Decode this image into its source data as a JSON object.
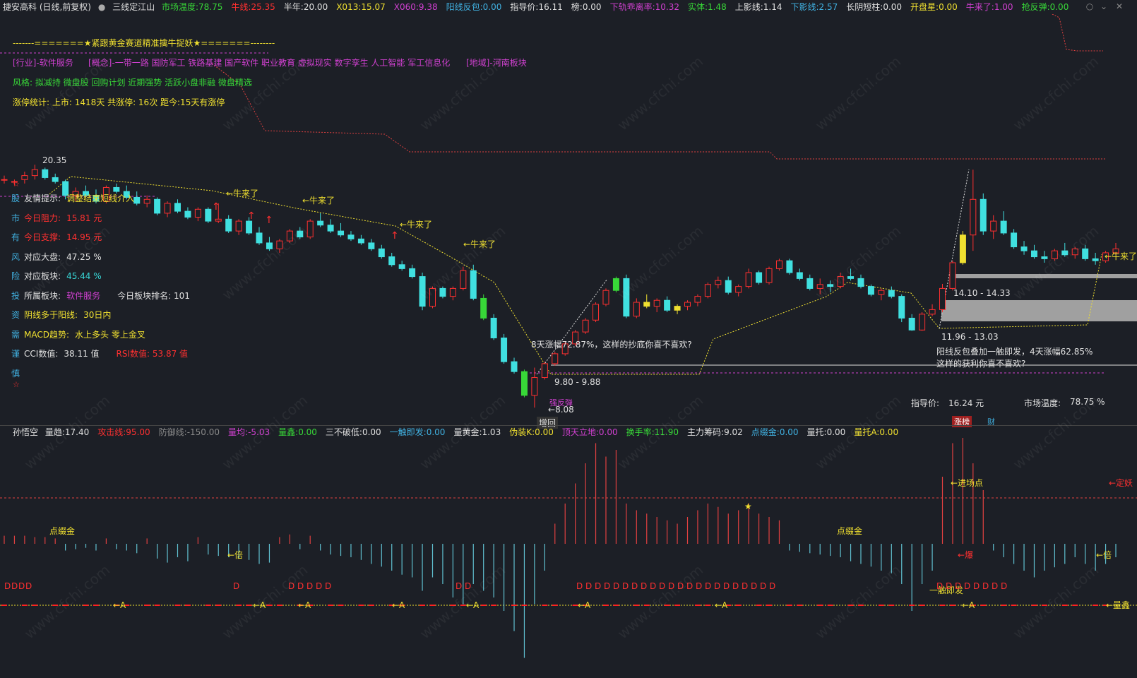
{
  "header": {
    "stock": "捷安高科 (日线,前复权)",
    "indicator": "三线定江山",
    "items": [
      {
        "label": "市场温度:",
        "value": "78.75",
        "color": "#38d838"
      },
      {
        "label": "牛线:",
        "value": "25.35",
        "color": "#ff3030"
      },
      {
        "label": "半年:",
        "value": "20.00",
        "color": "#e0e0e0"
      },
      {
        "label": "X013:",
        "value": "15.07",
        "color": "#f0e030"
      },
      {
        "label": "X060:",
        "value": "9.38",
        "color": "#d040d0"
      },
      {
        "label": "阳线反包:",
        "value": "0.00",
        "color": "#40b0e0"
      },
      {
        "label": "指导价:",
        "value": "16.11",
        "color": "#e0e0e0"
      },
      {
        "label": "榜:",
        "value": "0.00",
        "color": "#e0e0e0"
      },
      {
        "label": "下轨乖离率:",
        "value": "10.32",
        "color": "#d040d0"
      },
      {
        "label": "实体:",
        "value": "1.48",
        "color": "#38d838"
      },
      {
        "label": "上影线:",
        "value": "1.14",
        "color": "#e0e0e0"
      },
      {
        "label": "下影线:",
        "value": "2.57",
        "color": "#40b0e0"
      },
      {
        "label": "长阴短柱:",
        "value": "0.00",
        "color": "#e0e0e0"
      },
      {
        "label": "开盘星:",
        "value": "0.00",
        "color": "#f0e030"
      },
      {
        "label": "牛来了:",
        "value": "1.00",
        "color": "#d040d0"
      },
      {
        "label": "抢反弹:",
        "value": "0.00",
        "color": "#38d838"
      }
    ]
  },
  "overlay": {
    "banner": "-------=======★紧跟黄金赛道精准擒牛捉妖★=======--------",
    "industry": "[行业]-软件服务",
    "concept": "[概念]-一带一路 国防军工 铁路基建 国产软件 职业教育 虚拟现实 数字孪生 人工智能 军工信息化",
    "region": "[地域]-河南板块",
    "style": "风格: 拟减持 微盘股 回购计划 近期强势 活跃小盘非融 微盘精选",
    "limit_stats": "涨停统计:   上市: 1418天   共涨停: 16次   距今:15天有涨停"
  },
  "info_panel": [
    {
      "tag": "股",
      "label": "友情提示:",
      "value": "调整结束短线介入",
      "tag_color": "#40b0e0",
      "label_color": "#e0e0e0",
      "value_color": "#f0e030"
    },
    {
      "tag": "市",
      "label": "今日阻力:",
      "value": "15.81 元",
      "tag_color": "#40b0e0",
      "label_color": "#ff3030",
      "value_color": "#ff3030"
    },
    {
      "tag": "有",
      "label": "今日支撑:",
      "value": "14.95 元",
      "tag_color": "#40b0e0",
      "label_color": "#ff3030",
      "value_color": "#ff3030"
    },
    {
      "tag": "风",
      "label": "对应大盘:",
      "value": "47.25 %",
      "tag_color": "#40b0e0",
      "label_color": "#e0e0e0",
      "value_color": "#e0e0e0"
    },
    {
      "tag": "险",
      "label": "对应板块:",
      "value": "45.44 %",
      "tag_color": "#40b0e0",
      "label_color": "#e0e0e0",
      "value_color": "#38d8d8"
    },
    {
      "tag": "投",
      "label": "所属板块:",
      "value": "软件服务",
      "extra_label": "今日板块排名:",
      "extra_value": "101",
      "tag_color": "#40b0e0",
      "label_color": "#e0e0e0",
      "value_color": "#d040d0"
    },
    {
      "tag": "资",
      "label": "阴线多于阳线:",
      "value": "30日内",
      "tag_color": "#40b0e0",
      "label_color": "#f0e030",
      "value_color": "#f0e030"
    },
    {
      "tag": "需",
      "label": "MACD趋势:",
      "value": "水上多头 零上金叉",
      "tag_color": "#40b0e0",
      "label_color": "#f0e030",
      "value_color": "#f0e030"
    },
    {
      "tag": "谨",
      "label": "CCI数值:",
      "value": "38.11 值",
      "extra_label": "RSI数值:",
      "extra_value": "53.87 值",
      "tag_color": "#40b0e0",
      "label_color": "#e0e0e0",
      "value_color": "#e0e0e0"
    },
    {
      "tag": "慎",
      "label": "",
      "value": "",
      "tag_color": "#40b0e0",
      "label_color": "#e0e0e0",
      "value_color": "#e0e0e0"
    }
  ],
  "annotations": {
    "high_label": "20.35",
    "low_label": "8.08",
    "bull_label": "牛来了",
    "bull_arrow_label": "←牛来了",
    "rally1": "8天涨幅72.87%，这样的抄底你喜不喜欢?",
    "rally2_line1": "阳线反包叠加一触即发，4天涨幅62.85%",
    "rally2_line2": "这样的获利你喜不喜欢?",
    "box1": "14.10 - 14.33",
    "box2": "11.96 - 13.03",
    "box3": "9.80 - 9.88",
    "pullback": "增回",
    "guide_price_label": "指导价:",
    "guide_price_value": "16.24 元",
    "market_temp_label": "市场温度:",
    "market_temp_value": "78.75 %",
    "zhangbang": "涨榜",
    "cai": "财",
    "low_pink": "强反弹"
  },
  "sub_header": {
    "name": "孙悟空",
    "items": [
      {
        "label": "量趋:",
        "value": "17.40",
        "color": "#e0e0e0"
      },
      {
        "label": "攻击线:",
        "value": "95.00",
        "color": "#ff3030"
      },
      {
        "label": "防御线:",
        "value": "-150.00",
        "color": "#888888"
      },
      {
        "label": "量均:",
        "value": "-5.03",
        "color": "#d040d0"
      },
      {
        "label": "量鑫:",
        "value": "0.00",
        "color": "#38d838"
      },
      {
        "label": "三不破低:",
        "value": "0.00",
        "color": "#e0e0e0"
      },
      {
        "label": "一触即发:",
        "value": "0.00",
        "color": "#40b0e0"
      },
      {
        "label": "量黄金:",
        "value": "1.03",
        "color": "#e0e0e0"
      },
      {
        "label": "伪装K:",
        "value": "0.00",
        "color": "#f0e030"
      },
      {
        "label": "顶天立地:",
        "value": "0.00",
        "color": "#d040d0"
      },
      {
        "label": "换手率:",
        "value": "11.90",
        "color": "#38d838"
      },
      {
        "label": "主力筹码:",
        "value": "9.02",
        "color": "#e0e0e0"
      },
      {
        "label": "点缀金:",
        "value": "0.00",
        "color": "#40b0e0"
      },
      {
        "label": "量托:",
        "value": "0.00",
        "color": "#e0e0e0"
      },
      {
        "label": "量托A:",
        "value": "0.00",
        "color": "#f0e030"
      }
    ],
    "labels": {
      "dingyao": "定妖",
      "liangxin": "量鑫",
      "jinchangdian": "进场点",
      "dianzhuijin": "点缀金",
      "bei": "←倍",
      "bao": "←爆",
      "yichujifa": "一触即发",
      "arrow_a": "←A",
      "d": "D"
    }
  },
  "chart_data": {
    "type": "candlestick",
    "title": "",
    "ylabel": "",
    "candles": [
      [
        19.6,
        19.8,
        19.4,
        19.6
      ],
      [
        19.5,
        19.6,
        19.3,
        19.5
      ],
      [
        19.6,
        20.0,
        19.4,
        19.8
      ],
      [
        19.8,
        20.35,
        19.6,
        20.1
      ],
      [
        20.1,
        20.2,
        19.6,
        19.7
      ],
      [
        19.7,
        19.9,
        19.4,
        19.5
      ],
      [
        19.5,
        19.6,
        18.6,
        18.8
      ],
      [
        18.8,
        19.2,
        18.5,
        19.0
      ],
      [
        19.0,
        19.3,
        18.7,
        18.8
      ],
      [
        18.8,
        19.1,
        18.4,
        18.5
      ],
      [
        18.5,
        19.3,
        18.4,
        19.2
      ],
      [
        19.2,
        19.4,
        18.9,
        19.0
      ],
      [
        19.0,
        19.3,
        18.6,
        18.7
      ],
      [
        18.7,
        19.0,
        18.3,
        18.4
      ],
      [
        18.4,
        18.8,
        18.2,
        18.6
      ],
      [
        18.6,
        18.7,
        17.8,
        17.9
      ],
      [
        17.9,
        18.5,
        17.7,
        18.4
      ],
      [
        18.4,
        18.6,
        17.9,
        18.0
      ],
      [
        18.0,
        18.2,
        17.6,
        17.7
      ],
      [
        17.7,
        18.2,
        17.5,
        18.1
      ],
      [
        18.1,
        18.2,
        17.4,
        17.5
      ],
      [
        17.5,
        18.4,
        17.4,
        17.6
      ],
      [
        17.6,
        17.8,
        16.9,
        17.0
      ],
      [
        17.0,
        17.6,
        16.8,
        17.5
      ],
      [
        17.5,
        17.7,
        16.8,
        16.9
      ],
      [
        16.9,
        17.2,
        16.3,
        16.4
      ],
      [
        16.4,
        16.7,
        16.0,
        16.1
      ],
      [
        16.1,
        16.6,
        15.9,
        16.5
      ],
      [
        16.5,
        17.1,
        16.4,
        17.0
      ],
      [
        17.0,
        17.2,
        16.6,
        16.7
      ],
      [
        16.7,
        17.6,
        16.6,
        17.5
      ],
      [
        17.5,
        17.9,
        17.2,
        17.3
      ],
      [
        17.3,
        17.6,
        16.9,
        17.0
      ],
      [
        17.0,
        17.4,
        16.7,
        16.8
      ],
      [
        16.8,
        17.0,
        16.5,
        16.6
      ],
      [
        16.6,
        16.8,
        16.3,
        16.4
      ],
      [
        16.4,
        16.6,
        16.0,
        16.1
      ],
      [
        16.1,
        16.3,
        15.6,
        15.7
      ],
      [
        15.7,
        15.9,
        15.2,
        15.3
      ],
      [
        15.3,
        15.5,
        15.0,
        15.1
      ],
      [
        15.1,
        15.3,
        14.6,
        14.7
      ],
      [
        14.7,
        14.9,
        13.0,
        13.2
      ],
      [
        13.2,
        14.2,
        13.1,
        14.1
      ],
      [
        14.1,
        14.2,
        13.6,
        13.7
      ],
      [
        13.7,
        14.2,
        13.5,
        14.1
      ],
      [
        14.1,
        15.2,
        14.0,
        15.0
      ],
      [
        15.0,
        15.3,
        13.5,
        13.6
      ],
      [
        13.6,
        13.8,
        12.5,
        12.6
      ],
      [
        12.6,
        12.8,
        11.5,
        11.6
      ],
      [
        11.6,
        11.8,
        10.3,
        10.4
      ],
      [
        10.4,
        10.6,
        9.8,
        9.9
      ],
      [
        9.9,
        10.0,
        8.6,
        8.7
      ],
      [
        8.7,
        10.1,
        8.08,
        9.6
      ],
      [
        9.6,
        10.4,
        9.5,
        10.3
      ],
      [
        10.3,
        10.9,
        10.2,
        10.8
      ],
      [
        10.8,
        11.4,
        10.7,
        11.3
      ],
      [
        11.3,
        12.0,
        11.2,
        11.9
      ],
      [
        11.9,
        12.6,
        11.8,
        12.5
      ],
      [
        12.5,
        13.4,
        12.4,
        13.3
      ],
      [
        13.3,
        14.1,
        13.2,
        14.0
      ],
      [
        14.0,
        14.7,
        13.9,
        14.6
      ],
      [
        14.6,
        14.8,
        12.6,
        12.7
      ],
      [
        12.7,
        13.6,
        12.6,
        13.4
      ],
      [
        13.4,
        13.8,
        13.1,
        13.2
      ],
      [
        13.2,
        13.6,
        12.9,
        13.5
      ],
      [
        13.5,
        13.7,
        12.9,
        13.0
      ],
      [
        13.0,
        13.3,
        12.8,
        13.2
      ],
      [
        13.2,
        13.5,
        13.0,
        13.4
      ],
      [
        13.4,
        13.8,
        13.2,
        13.7
      ],
      [
        13.7,
        14.4,
        13.6,
        14.3
      ],
      [
        14.3,
        14.7,
        14.1,
        14.5
      ],
      [
        14.5,
        14.7,
        13.8,
        13.9
      ],
      [
        13.9,
        14.3,
        13.7,
        14.2
      ],
      [
        14.2,
        15.1,
        14.1,
        14.9
      ],
      [
        14.9,
        15.0,
        14.3,
        14.4
      ],
      [
        14.4,
        15.2,
        14.3,
        15.1
      ],
      [
        15.1,
        15.6,
        15.0,
        15.5
      ],
      [
        15.5,
        15.6,
        14.8,
        14.9
      ],
      [
        14.9,
        15.1,
        14.5,
        14.6
      ],
      [
        14.6,
        14.8,
        14.0,
        14.1
      ],
      [
        14.1,
        14.6,
        13.8,
        14.3
      ],
      [
        14.3,
        14.5,
        13.9,
        14.2
      ],
      [
        14.2,
        14.9,
        14.1,
        14.7
      ],
      [
        14.7,
        15.1,
        14.5,
        14.6
      ],
      [
        14.6,
        14.8,
        14.1,
        14.2
      ],
      [
        14.2,
        14.3,
        13.7,
        13.8
      ],
      [
        13.8,
        14.1,
        13.5,
        14.0
      ],
      [
        14.0,
        14.2,
        13.6,
        13.7
      ],
      [
        13.7,
        13.8,
        12.4,
        12.6
      ],
      [
        12.6,
        12.8,
        11.96,
        12.0
      ],
      [
        12.0,
        12.9,
        11.96,
        12.8
      ],
      [
        12.8,
        13.3,
        12.7,
        13.03
      ],
      [
        13.03,
        14.33,
        12.9,
        14.1
      ],
      [
        14.1,
        15.5,
        14.0,
        15.4
      ],
      [
        15.4,
        17.0,
        15.3,
        16.8
      ],
      [
        16.8,
        20.1,
        16.0,
        18.6
      ],
      [
        18.6,
        18.9,
        16.8,
        17.0
      ],
      [
        17.0,
        17.8,
        16.6,
        17.5
      ],
      [
        17.5,
        18.0,
        16.8,
        16.9
      ],
      [
        16.9,
        17.1,
        16.1,
        16.2
      ],
      [
        16.2,
        16.5,
        15.8,
        16.0
      ],
      [
        16.0,
        16.3,
        15.6,
        15.7
      ],
      [
        15.7,
        16.0,
        15.4,
        15.6
      ],
      [
        15.6,
        16.1,
        15.5,
        16.0
      ],
      [
        16.0,
        16.4,
        15.7,
        15.8
      ],
      [
        15.8,
        16.2,
        15.6,
        16.1
      ],
      [
        16.1,
        16.3,
        15.5,
        15.6
      ],
      [
        15.6,
        15.9,
        15.3,
        15.5
      ],
      [
        15.5,
        16.0,
        15.4,
        15.9
      ],
      [
        15.9,
        16.4,
        15.8,
        16.1
      ]
    ],
    "volume_bars": [
      12,
      12,
      12,
      10,
      10,
      8,
      -10,
      -8,
      -6,
      -10,
      8,
      -8,
      -10,
      -14,
      8,
      -22,
      -28,
      -20,
      -26,
      10,
      -16,
      -18,
      -20,
      -22,
      -24,
      -30,
      -28,
      10,
      14,
      -8,
      12,
      -10,
      -16,
      -18,
      -20,
      -24,
      -30,
      -34,
      -40,
      -46,
      -50,
      -70,
      -50,
      -60,
      -80,
      -90,
      -60,
      -70,
      -80,
      -100,
      -130,
      -170,
      -90,
      -40,
      30,
      60,
      90,
      120,
      150,
      130,
      140,
      60,
      50,
      45,
      40,
      35,
      30,
      40,
      50,
      60,
      55,
      45,
      50,
      60,
      45,
      40,
      35,
      -10,
      -12,
      -14,
      -16,
      -18,
      -20,
      -26,
      -30,
      -34,
      -40,
      -44,
      -60,
      -100,
      -60,
      -40,
      100,
      150,
      160,
      120,
      80,
      -10,
      -20,
      -30,
      -40,
      -50,
      -40,
      -35,
      -30,
      -20,
      -30,
      -40,
      -30,
      -20
    ]
  },
  "watermark": "www.cfchi.com"
}
